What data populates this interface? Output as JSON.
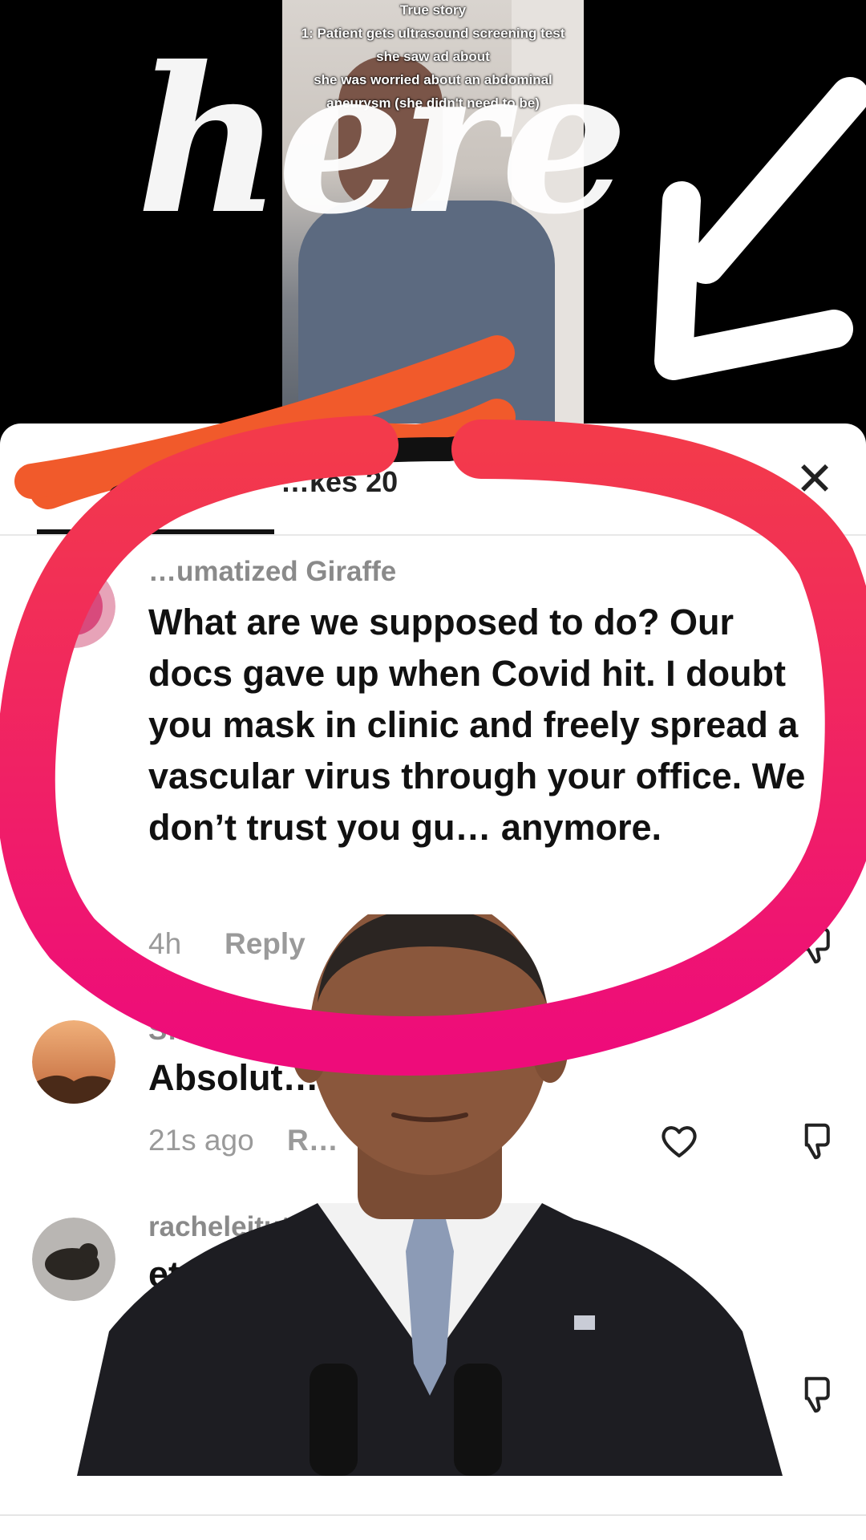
{
  "video": {
    "caption_lines": [
      "True story",
      "1: Patient gets ultrasound screening test",
      "she saw ad about",
      "she was worried about an abdominal",
      "aneurysm (she didn't need to be)"
    ],
    "overlay_word": "here",
    "scribble_color": "#ffffff"
  },
  "sheet": {
    "comment_count_label": "…kes 20",
    "close_icon": "close-icon"
  },
  "comments": [
    {
      "username": "…umatized Giraffe",
      "text": "What are we supposed to do? Our docs gave up when Covid hit. I doubt you mask in clinic and freely spread a vascular virus through your office. We don’t trust you gu… anymore.",
      "time": "4h",
      "reply_label": "Reply"
    },
    {
      "username": "S…",
      "text": "Absolut… …ly is. M",
      "time": "21s ago",
      "reply_label": "R…"
    },
    {
      "username": "racheleitutis",
      "text": "etc,etc",
      "time": "",
      "reply_label": ""
    }
  ],
  "overlay": {
    "circle_color": "#f0156e",
    "strike_orange": "#f15a2b",
    "strike_black": "#111111"
  }
}
